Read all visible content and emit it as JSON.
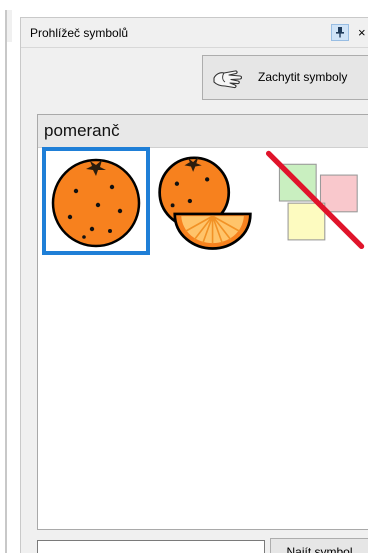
{
  "panel": {
    "title": "Prohlížeč symbolů",
    "close_glyph": "×",
    "pin_icon": "pin-icon"
  },
  "toolbar": {
    "capture_label": "Zachytit symboly",
    "capture_icon": "hand-pointer-icon"
  },
  "symbols_view": {
    "heading": "pomeranč",
    "symbols": [
      {
        "icon": "orange-icon",
        "selected": true
      },
      {
        "icon": "orange-with-slice-icon",
        "selected": false
      },
      {
        "icon": "no-symbol-icon",
        "selected": false
      }
    ]
  },
  "search": {
    "value": "",
    "placeholder": "",
    "button_label": "Najít symbol"
  },
  "colors": {
    "selection": "#1f7fd7",
    "orange": "#f7811e",
    "cross": "#e0142b"
  }
}
